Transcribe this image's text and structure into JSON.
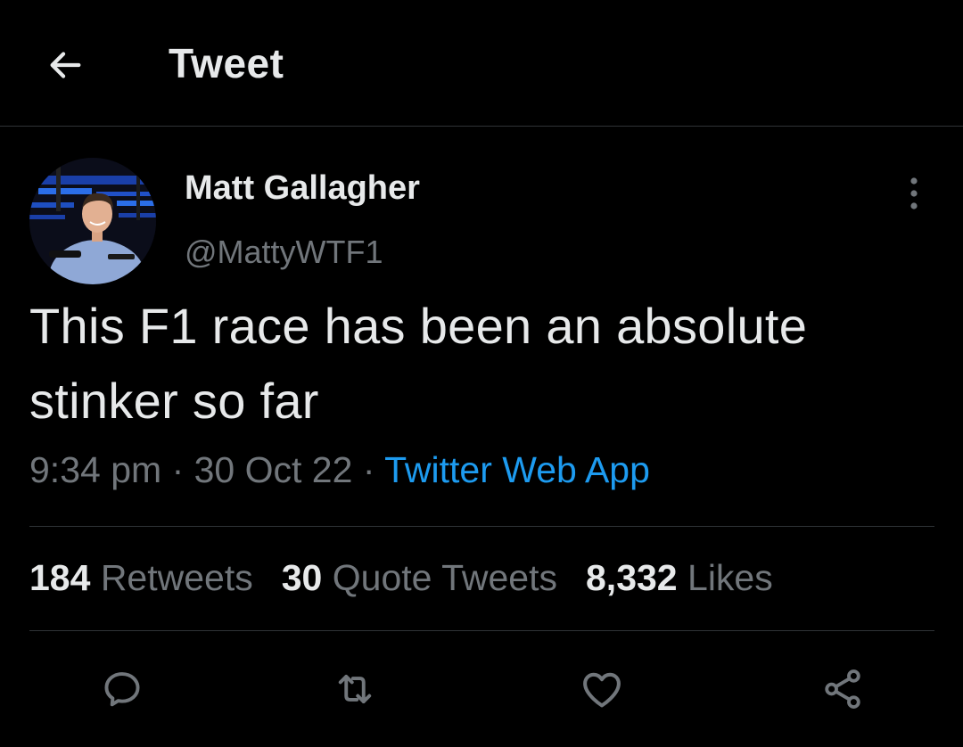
{
  "header": {
    "title": "Tweet"
  },
  "tweet": {
    "display_name": "Matt Gallagher",
    "handle": "@MattyWTF1",
    "text": "This F1 race has been an absolute stinker so far",
    "time": "9:34 pm",
    "separator": "·",
    "date": "30 Oct 22",
    "source": "Twitter Web App"
  },
  "stats": {
    "retweets_count": "184",
    "retweets_label": "Retweets",
    "quotes_count": "30",
    "quotes_label": "Quote Tweets",
    "likes_count": "8,332",
    "likes_label": "Likes"
  },
  "actions": [
    "reply-icon",
    "retweet-icon",
    "like-icon",
    "share-icon"
  ],
  "colors": {
    "background": "#000000",
    "text": "#e7e9ea",
    "secondary": "#71767b",
    "accent": "#1d9bf0",
    "divider": "#2f3336"
  }
}
